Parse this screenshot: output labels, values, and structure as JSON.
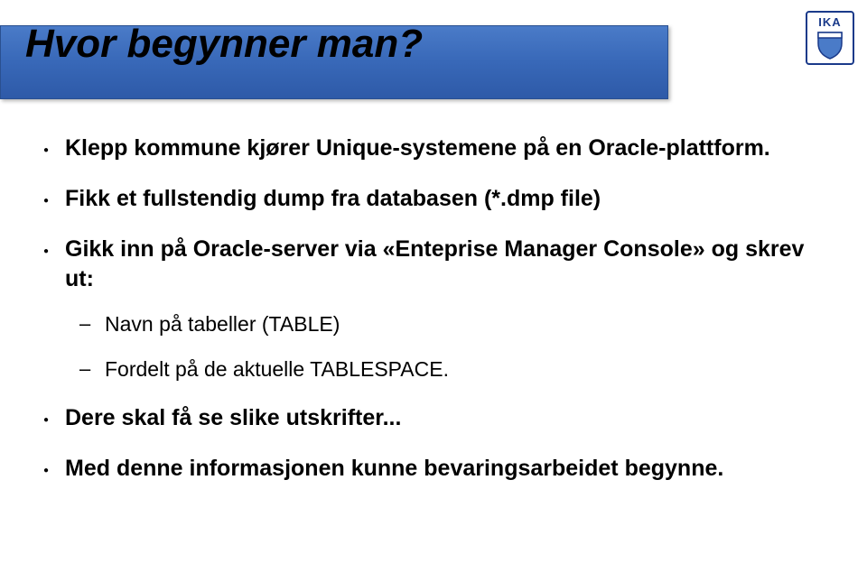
{
  "logo": {
    "text": "IKA"
  },
  "title": "Hvor begynner man?",
  "bullets": [
    {
      "text": "Klepp kommune kjører Unique-systemene på en Oracle-plattform."
    },
    {
      "text": "Fikk et fullstendig dump fra databasen (*.dmp file)"
    },
    {
      "text": "Gikk inn på Oracle-server via «Enteprise Manager Console» og skrev ut:",
      "subitems": [
        "Navn på tabeller (TABLE)",
        "Fordelt på de aktuelle TABLESPACE."
      ]
    },
    {
      "text": "Dere skal få se slike utskrifter..."
    },
    {
      "text": "Med denne informasjonen kunne bevaringsarbeidet begynne."
    }
  ]
}
